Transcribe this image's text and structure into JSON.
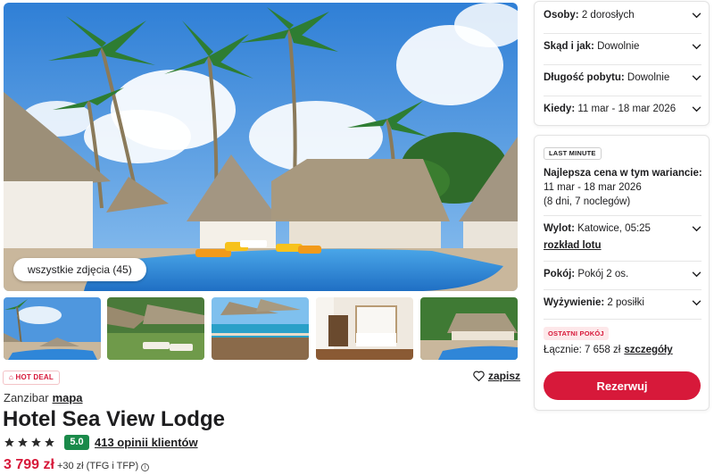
{
  "gallery": {
    "all_photos_label": "wszystkie zdjęcia (45)",
    "thumbnails": [
      "beach-pool",
      "thatched-huts",
      "terrace-sea",
      "bedroom",
      "pool-garden"
    ]
  },
  "hotel": {
    "hot_deal_label": "HOT DEAL",
    "save_label": "zapisz",
    "location": "Zanzibar",
    "map_label": "mapa",
    "name": "Hotel Sea View Lodge",
    "stars": 4,
    "score": "5.0",
    "reviews_label": "413 opinii klientów",
    "price": "3 799 zł",
    "price_extra": "+30 zł (TFG i TFP)"
  },
  "search": {
    "persons_label": "Osoby:",
    "persons_value": "2 dorosłych",
    "from_label": "Skąd i jak:",
    "from_value": "Dowolnie",
    "duration_label": "Długość pobytu:",
    "duration_value": "Dowolnie",
    "when_label": "Kiedy:",
    "when_value": "11 mar - 18 mar 2026"
  },
  "offer": {
    "badge": "LAST MINUTE",
    "best_price_title": "Najlepsza cena w tym wariancie:",
    "dates": "11 mar - 18 mar 2026",
    "nights": "(8 dni, 7 noclegów)",
    "departure_label": "Wylot:",
    "departure_value": "Katowice, 05:25",
    "flight_schedule_label": "rozkład lotu",
    "room_label": "Pokój:",
    "room_value": "Pokój 2 os.",
    "board_label": "Wyżywienie:",
    "board_value": "2 posiłki",
    "last_room_badge": "OSTATNI POKÓJ",
    "total_label": "Łącznie: 7 658 zł",
    "details_label": "szczegóły",
    "book_label": "Rezerwuj"
  },
  "colors": {
    "accent": "#d7193a",
    "score_bg": "#1a8a4a"
  }
}
